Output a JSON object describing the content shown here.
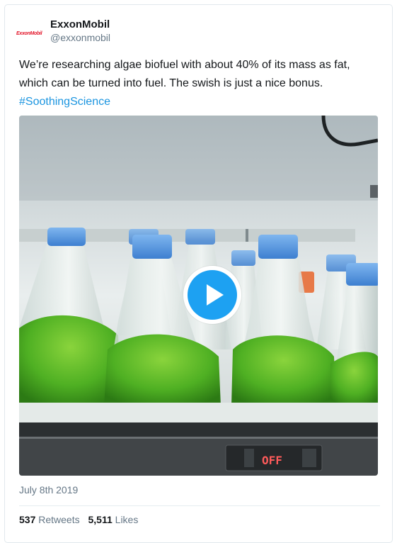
{
  "account": {
    "logo_text": "ExxonMobil",
    "name": "ExxonMobil",
    "handle": "@exxonmobil"
  },
  "tweet": {
    "text": "We’re researching algae biofuel with about 40% of its mass as fat, which can be turned into fuel. The swish is just a nice bonus.",
    "hashtag": "#SoothingScience",
    "date": "July 8th 2019"
  },
  "media": {
    "type": "video",
    "icon": "play-icon",
    "display_text": "OFF"
  },
  "stats": {
    "retweets_count": "537",
    "retweets_label": "Retweets",
    "likes_count": "5,511",
    "likes_label": "Likes"
  },
  "colors": {
    "hashtag": "#1b95e0",
    "play_button": "#1da1f2",
    "logo_red": "#e3172b",
    "muted_text": "#657786"
  }
}
